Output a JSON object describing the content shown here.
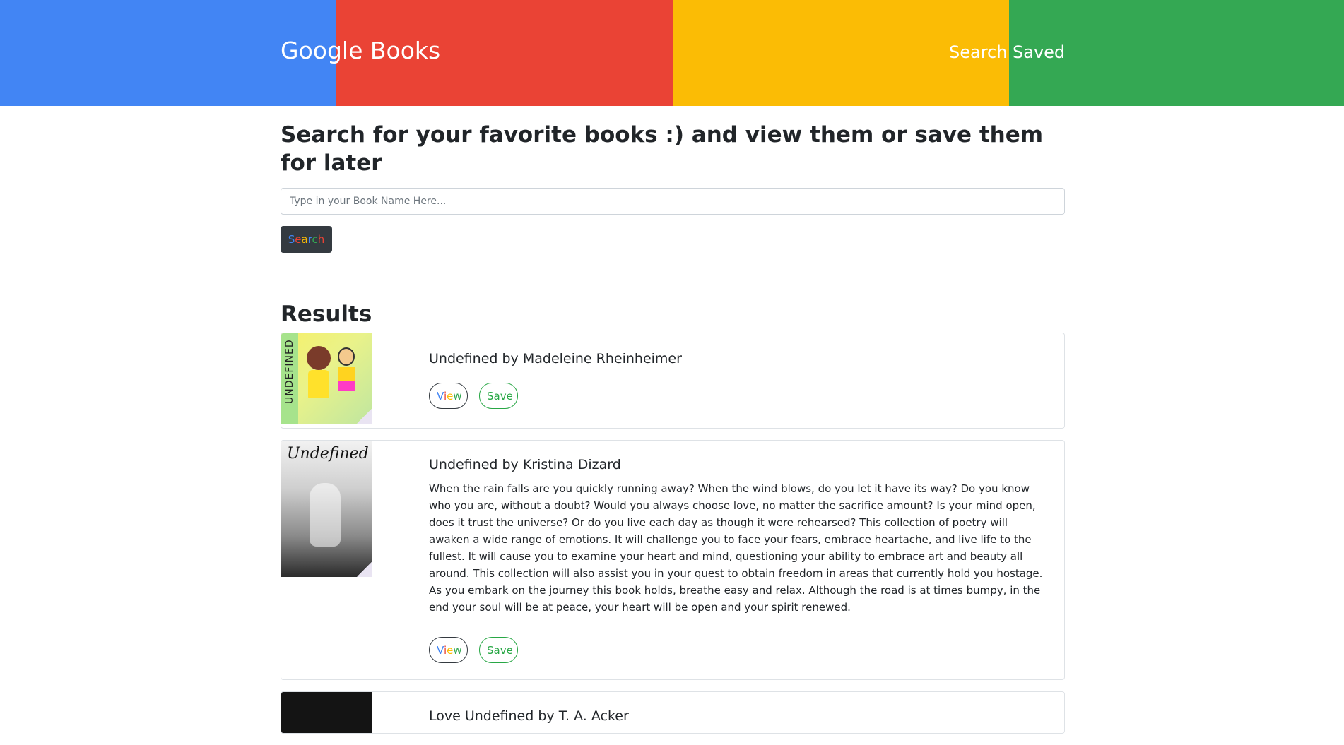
{
  "navbar": {
    "brand": "Google Books",
    "links": [
      "Search",
      "Saved"
    ],
    "colors": [
      "#4285f4",
      "#ea4335",
      "#fbbc05",
      "#34a853"
    ]
  },
  "search": {
    "heading": "Search for your favorite books :) and view them or save them for later",
    "placeholder": "Type in your Book Name Here...",
    "value": "",
    "button_letters": [
      "S",
      "e",
      "a",
      "r",
      "c",
      "h"
    ]
  },
  "results": {
    "heading": "Results",
    "view_letters": [
      "V",
      "i",
      "e",
      "w"
    ],
    "save_label": "Save",
    "books": [
      {
        "title": "Undefined by Madeleine Rheinheimer",
        "description": "",
        "cover_text": "UNDEFINED"
      },
      {
        "title": "Undefined by Kristina Dizard",
        "description": "When the rain falls are you quickly running away? When the wind blows, do you let it have its way? Do you know who you are, without a doubt? Would you always choose love, no matter the sacrifice amount? Is your mind open, does it trust the universe? Or do you live each day as though it were rehearsed? This collection of poetry will awaken a wide range of emotions. It will challenge you to face your fears, embrace heartache, and live life to the fullest. It will cause you to examine your heart and mind, questioning your ability to embrace art and beauty all around. This collection will also assist you in your quest to obtain freedom in areas that currently hold you hostage. As you embark on the journey this book holds, breathe easy and relax. Although the road is at times bumpy, in the end your soul will be at peace, your heart will be open and your spirit renewed.",
        "cover_text": "Undefined"
      },
      {
        "title": "Love Undefined by T. A. Acker",
        "description": "",
        "cover_text": ""
      }
    ]
  }
}
